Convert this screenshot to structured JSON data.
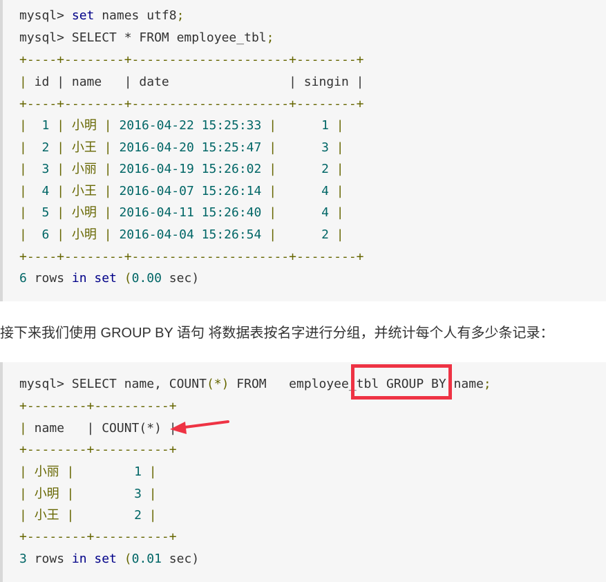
{
  "block1": {
    "cmd1": [
      "mysql> ",
      "set",
      " names utf8",
      ";"
    ],
    "cmd2": [
      "mysql> ",
      "SELECT * FROM employee_tbl",
      ";"
    ],
    "sep": "+----+--------+---------------------+--------+",
    "header": "| id | name   | date                | singin |",
    "rows": [
      {
        "id": "1",
        "name": "小明",
        "date": "2016-04-22 15:25:33",
        "singin": "1"
      },
      {
        "id": "2",
        "name": "小王",
        "date": "2016-04-20 15:25:47",
        "singin": "3"
      },
      {
        "id": "3",
        "name": "小丽",
        "date": "2016-04-19 15:26:02",
        "singin": "2"
      },
      {
        "id": "4",
        "name": "小王",
        "date": "2016-04-07 15:26:14",
        "singin": "4"
      },
      {
        "id": "5",
        "name": "小明",
        "date": "2016-04-11 15:26:40",
        "singin": "4"
      },
      {
        "id": "6",
        "name": "小明",
        "date": "2016-04-04 15:26:54",
        "singin": "2"
      }
    ],
    "footer": [
      "6",
      " rows ",
      "in",
      " ",
      "set",
      " (",
      "0.00",
      " sec)"
    ]
  },
  "paragraph": "接下来我们使用 GROUP BY 语句 将数据表按名字进行分组，并统计每个人有多少条记录：",
  "block2": {
    "cmd": [
      "mysql> SELECT name, COUNT",
      "(*)",
      " FROM   employee_tbl GROUP BY name",
      ";"
    ],
    "sep": "+--------+----------+",
    "header": "| name   | COUNT(*) |",
    "rows": [
      {
        "name": "小丽",
        "count": "1"
      },
      {
        "name": "小明",
        "count": "3"
      },
      {
        "name": "小王",
        "count": "2"
      }
    ],
    "footer": [
      "3",
      " rows ",
      "in",
      " ",
      "set",
      " (",
      "0.01",
      " sec)"
    ]
  },
  "annotation_colors": {
    "highlight_box": "#ee3344",
    "arrow": "#ee3344"
  }
}
